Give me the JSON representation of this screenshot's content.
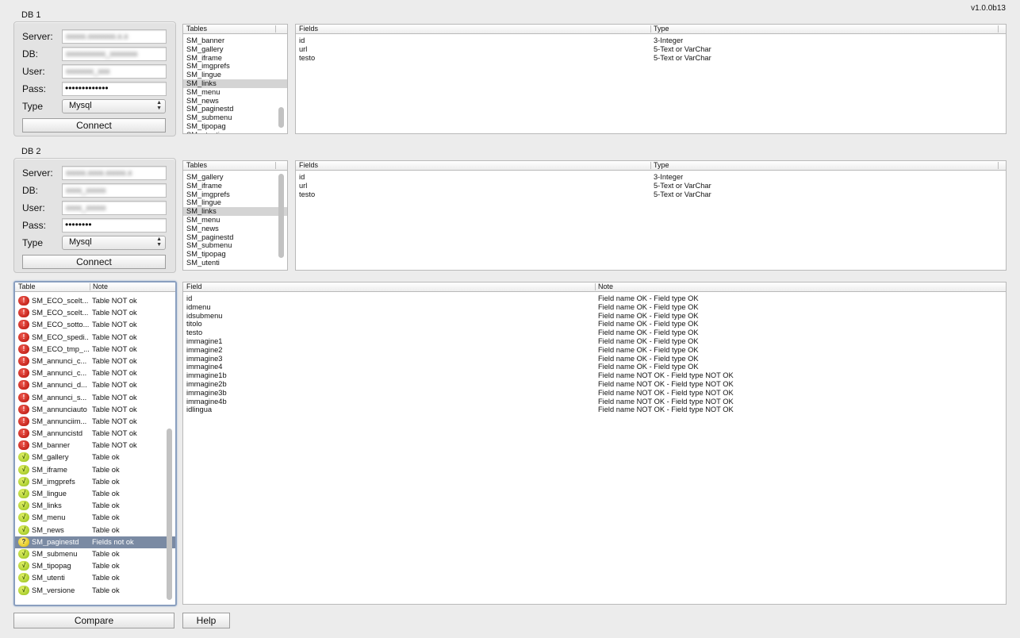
{
  "app": {
    "version": "v1.0.0b13"
  },
  "db1": {
    "title": "DB 1",
    "labels": {
      "server": "Server:",
      "db": "DB:",
      "user": "User:",
      "pass": "Pass:",
      "type": "Type"
    },
    "server_value": "xxxxx.xxxxxxx.x.x",
    "db_value": "xxxxxxxxxx_xxxxxxx",
    "user_value": "xxxxxxx_xxx",
    "pass_value": "•••••••••••••",
    "type_value": "Mysql",
    "connect_label": "Connect",
    "tables_header": "Tables",
    "tables": [
      "SM_banner",
      "SM_gallery",
      "SM_iframe",
      "SM_imgprefs",
      "SM_lingue",
      "SM_links",
      "SM_menu",
      "SM_news",
      "SM_paginestd",
      "SM_submenu",
      "SM_tipopag",
      "SM_utenti"
    ],
    "fields_header": "Fields",
    "type_header": "Type",
    "fields": [
      {
        "name": "id",
        "type": "3-Integer"
      },
      {
        "name": "url",
        "type": "5-Text or VarChar"
      },
      {
        "name": "testo",
        "type": "5-Text or VarChar"
      }
    ]
  },
  "db2": {
    "title": "DB 2",
    "labels": {
      "server": "Server:",
      "db": "DB:",
      "user": "User:",
      "pass": "Pass:",
      "type": "Type"
    },
    "server_value": "xxxxx.xxxx.xxxxx.x",
    "db_value": "xxxx_xxxxx",
    "user_value": "xxxx_xxxxx",
    "pass_value": "••••••••",
    "type_value": "Mysql",
    "connect_label": "Connect",
    "tables_header": "Tables",
    "tables": [
      "SM_gallery",
      "SM_iframe",
      "SM_imgprefs",
      "SM_lingue",
      "SM_links",
      "SM_menu",
      "SM_news",
      "SM_paginestd",
      "SM_submenu",
      "SM_tipopag",
      "SM_utenti"
    ],
    "fields_header": "Fields",
    "type_header": "Type",
    "fields": [
      {
        "name": "id",
        "type": "3-Integer"
      },
      {
        "name": "url",
        "type": "5-Text or VarChar"
      },
      {
        "name": "testo",
        "type": "5-Text or VarChar"
      }
    ]
  },
  "compare_list": {
    "col_table": "Table",
    "col_note": "Note",
    "rows": [
      {
        "status": "err",
        "name": "SM_ECO_scelt...",
        "note": "Table NOT ok"
      },
      {
        "status": "err",
        "name": "SM_ECO_scelt...",
        "note": "Table NOT ok"
      },
      {
        "status": "err",
        "name": "SM_ECO_sotto...",
        "note": "Table NOT ok"
      },
      {
        "status": "err",
        "name": "SM_ECO_spedi...",
        "note": "Table NOT ok"
      },
      {
        "status": "err",
        "name": "SM_ECO_tmp_...",
        "note": "Table NOT ok"
      },
      {
        "status": "err",
        "name": "SM_annunci_c...",
        "note": "Table NOT ok"
      },
      {
        "status": "err",
        "name": "SM_annunci_c...",
        "note": "Table NOT ok"
      },
      {
        "status": "err",
        "name": "SM_annunci_d...",
        "note": "Table NOT ok"
      },
      {
        "status": "err",
        "name": "SM_annunci_s...",
        "note": "Table NOT ok"
      },
      {
        "status": "err",
        "name": "SM_annunciauto",
        "note": "Table NOT ok"
      },
      {
        "status": "err",
        "name": "SM_annunciim...",
        "note": "Table NOT ok"
      },
      {
        "status": "err",
        "name": "SM_annuncistd",
        "note": "Table NOT ok"
      },
      {
        "status": "err",
        "name": "SM_banner",
        "note": "Table NOT ok"
      },
      {
        "status": "ok",
        "name": "SM_gallery",
        "note": "Table ok"
      },
      {
        "status": "ok",
        "name": "SM_iframe",
        "note": "Table ok"
      },
      {
        "status": "ok",
        "name": "SM_imgprefs",
        "note": "Table ok"
      },
      {
        "status": "ok",
        "name": "SM_lingue",
        "note": "Table ok"
      },
      {
        "status": "ok",
        "name": "SM_links",
        "note": "Table ok"
      },
      {
        "status": "ok",
        "name": "SM_menu",
        "note": "Table ok"
      },
      {
        "status": "ok",
        "name": "SM_news",
        "note": "Table ok"
      },
      {
        "status": "warn",
        "name": "SM_paginestd",
        "note": "Fields not ok"
      },
      {
        "status": "ok",
        "name": "SM_submenu",
        "note": "Table ok"
      },
      {
        "status": "ok",
        "name": "SM_tipopag",
        "note": "Table ok"
      },
      {
        "status": "ok",
        "name": "SM_utenti",
        "note": "Table ok"
      },
      {
        "status": "ok",
        "name": "SM_versione",
        "note": "Table ok"
      }
    ]
  },
  "field_detail": {
    "col_field": "Field",
    "col_note": "Note",
    "rows": [
      {
        "field": "id",
        "note": "Field name OK  - Field type OK"
      },
      {
        "field": "idmenu",
        "note": "Field name OK  - Field type OK"
      },
      {
        "field": "idsubmenu",
        "note": "Field name OK  - Field type OK"
      },
      {
        "field": "titolo",
        "note": "Field name OK  - Field type OK"
      },
      {
        "field": "testo",
        "note": "Field name OK  - Field type OK"
      },
      {
        "field": "immagine1",
        "note": "Field name OK  - Field type OK"
      },
      {
        "field": "immagine2",
        "note": "Field name OK  - Field type OK"
      },
      {
        "field": "immagine3",
        "note": "Field name OK  - Field type OK"
      },
      {
        "field": "immagine4",
        "note": "Field name OK  - Field type OK"
      },
      {
        "field": "immagine1b",
        "note": "Field name NOT OK  - Field type NOT OK"
      },
      {
        "field": "immagine2b",
        "note": "Field name NOT OK  - Field type NOT OK"
      },
      {
        "field": "immagine3b",
        "note": "Field name NOT OK  - Field type NOT OK"
      },
      {
        "field": "immagine4b",
        "note": "Field name NOT OK  - Field type NOT OK"
      },
      {
        "field": "idlingua",
        "note": "Field name NOT OK  - Field type NOT OK"
      }
    ]
  },
  "buttons": {
    "compare": "Compare",
    "help": "Help"
  },
  "icons": {
    "err": "!",
    "ok": "√",
    "warn": "?"
  },
  "colors": {
    "selection": "#7a8aa3",
    "error": "#d0140a",
    "ok": "#a6d01a",
    "warn": "#f0d000"
  }
}
